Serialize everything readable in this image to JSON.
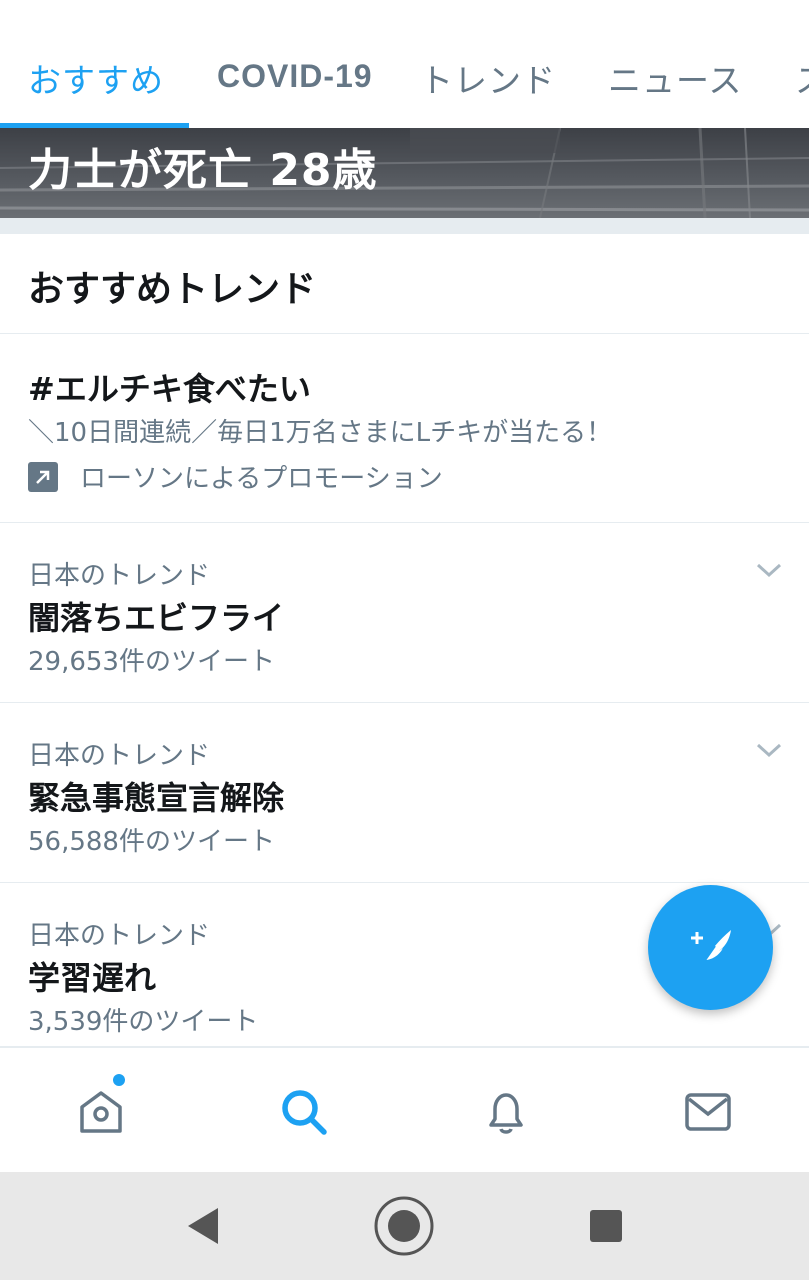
{
  "tabs": [
    {
      "label": "おすすめ",
      "active": true
    },
    {
      "label": "COVID-19",
      "active": false
    },
    {
      "label": "トレンド",
      "active": false
    },
    {
      "label": "ニュース",
      "active": false
    },
    {
      "label": "ス",
      "active": false
    }
  ],
  "hero": {
    "title": "力士が死亡 28歳"
  },
  "section": {
    "title": "おすすめトレンド"
  },
  "promo": {
    "title": "#エルチキ食べたい",
    "description": "＼10日間連続／毎日1万名さまにLチキが当たる！",
    "promoted_by": "ローソンによるプロモーション"
  },
  "trends": [
    {
      "context": "日本のトレンド",
      "name": "闇落ちエビフライ",
      "count": "29,653件のツイート"
    },
    {
      "context": "日本のトレンド",
      "name": "緊急事態宣言解除",
      "count": "56,588件のツイート"
    },
    {
      "context": "日本のトレンド",
      "name": "学習遅れ",
      "count": "3,539件のツイート"
    }
  ],
  "bottom_nav": {
    "items": [
      "home-icon",
      "search-icon",
      "bell-icon",
      "mail-icon"
    ],
    "active": "search-icon",
    "home_has_notification": true
  },
  "colors": {
    "accent": "#1da1f2",
    "muted": "#657786",
    "text": "#14171a",
    "divider": "#e6ecf0"
  }
}
